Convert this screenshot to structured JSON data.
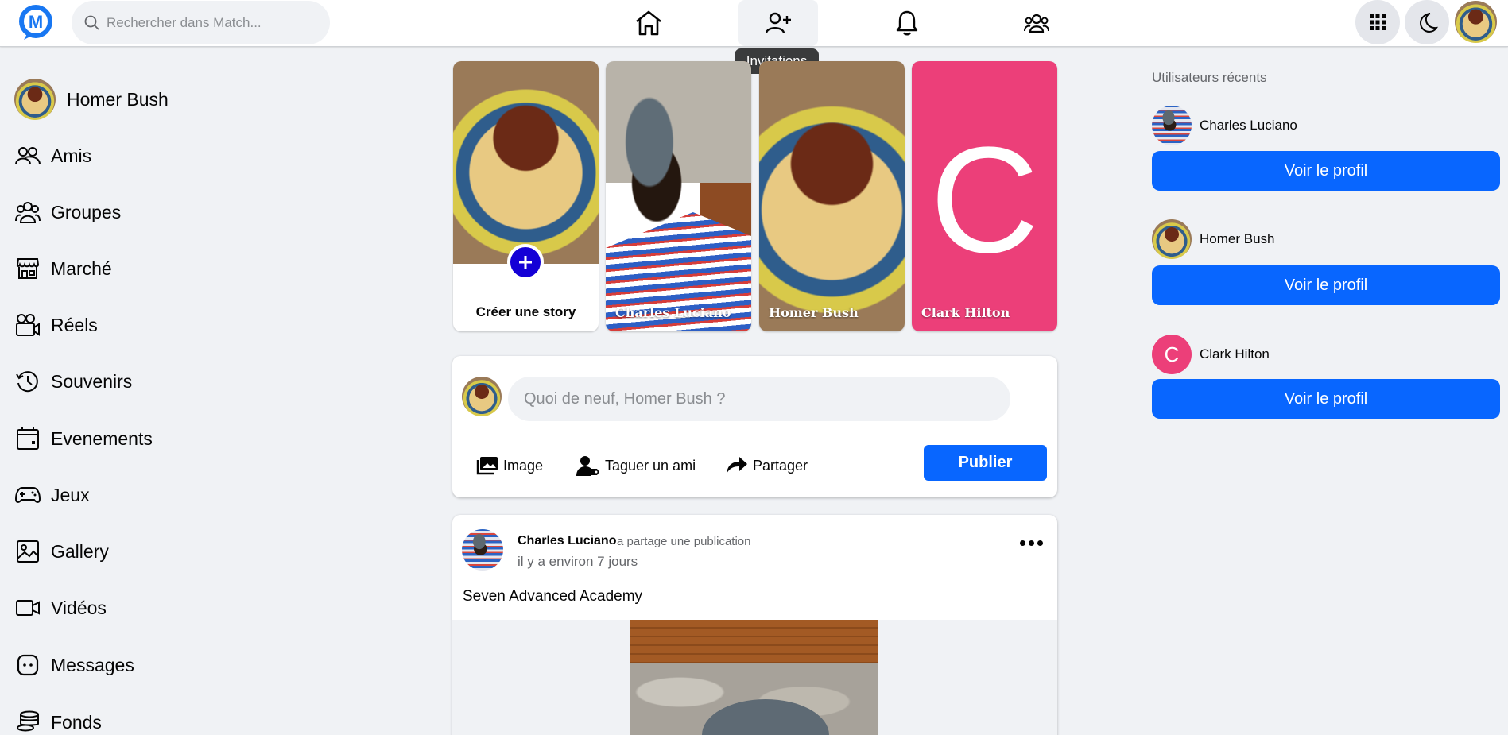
{
  "header": {
    "search_placeholder": "Rechercher dans Match...",
    "tooltip": "Invitations",
    "nav": [
      "home-icon",
      "friend-invitations-icon",
      "notifications-bell-icon",
      "groups-icon"
    ],
    "right_buttons": [
      "apps-grid-icon",
      "dark-mode-moon-icon"
    ]
  },
  "sidebar": {
    "profile_name": "Homer Bush",
    "items": [
      {
        "label": "Amis",
        "icon": "friends-icon"
      },
      {
        "label": "Groupes",
        "icon": "groups-icon"
      },
      {
        "label": "Marché",
        "icon": "marketplace-icon"
      },
      {
        "label": "Réels",
        "icon": "reels-camera-icon"
      },
      {
        "label": "Souvenirs",
        "icon": "memories-clock-icon"
      },
      {
        "label": "Evenements",
        "icon": "events-calendar-icon"
      },
      {
        "label": "Jeux",
        "icon": "gamepad-icon"
      },
      {
        "label": "Gallery",
        "icon": "gallery-image-icon"
      },
      {
        "label": "Vidéos",
        "icon": "video-camera-icon"
      },
      {
        "label": "Messages",
        "icon": "messages-icon"
      },
      {
        "label": "Fonds",
        "icon": "coins-icon"
      }
    ]
  },
  "stories": {
    "create_label": "Créer une story",
    "items": [
      {
        "name": "Charles Luciano"
      },
      {
        "name": "Homer Bush"
      },
      {
        "name": "Clark Hilton",
        "letter": "C"
      }
    ]
  },
  "composer": {
    "placeholder": "Quoi de neuf, Homer Bush ?",
    "image_label": "Image",
    "tag_label": "Taguer un ami",
    "share_label": "Partager",
    "publish_label": "Publier"
  },
  "post": {
    "author": "Charles Luciano",
    "action": "a partage une publication",
    "time": "il y a environ 7 jours",
    "text": "Seven Advanced Academy"
  },
  "recent_users": {
    "title": "Utilisateurs récents",
    "button_label": "Voir le profil",
    "users": [
      {
        "name": "Charles Luciano"
      },
      {
        "name": "Homer Bush"
      },
      {
        "name": "Clark Hilton",
        "letter": "C"
      }
    ]
  },
  "colors": {
    "primary": "#0866ff",
    "story_pink": "#ec3f79",
    "plus_blue": "#1400d6"
  }
}
